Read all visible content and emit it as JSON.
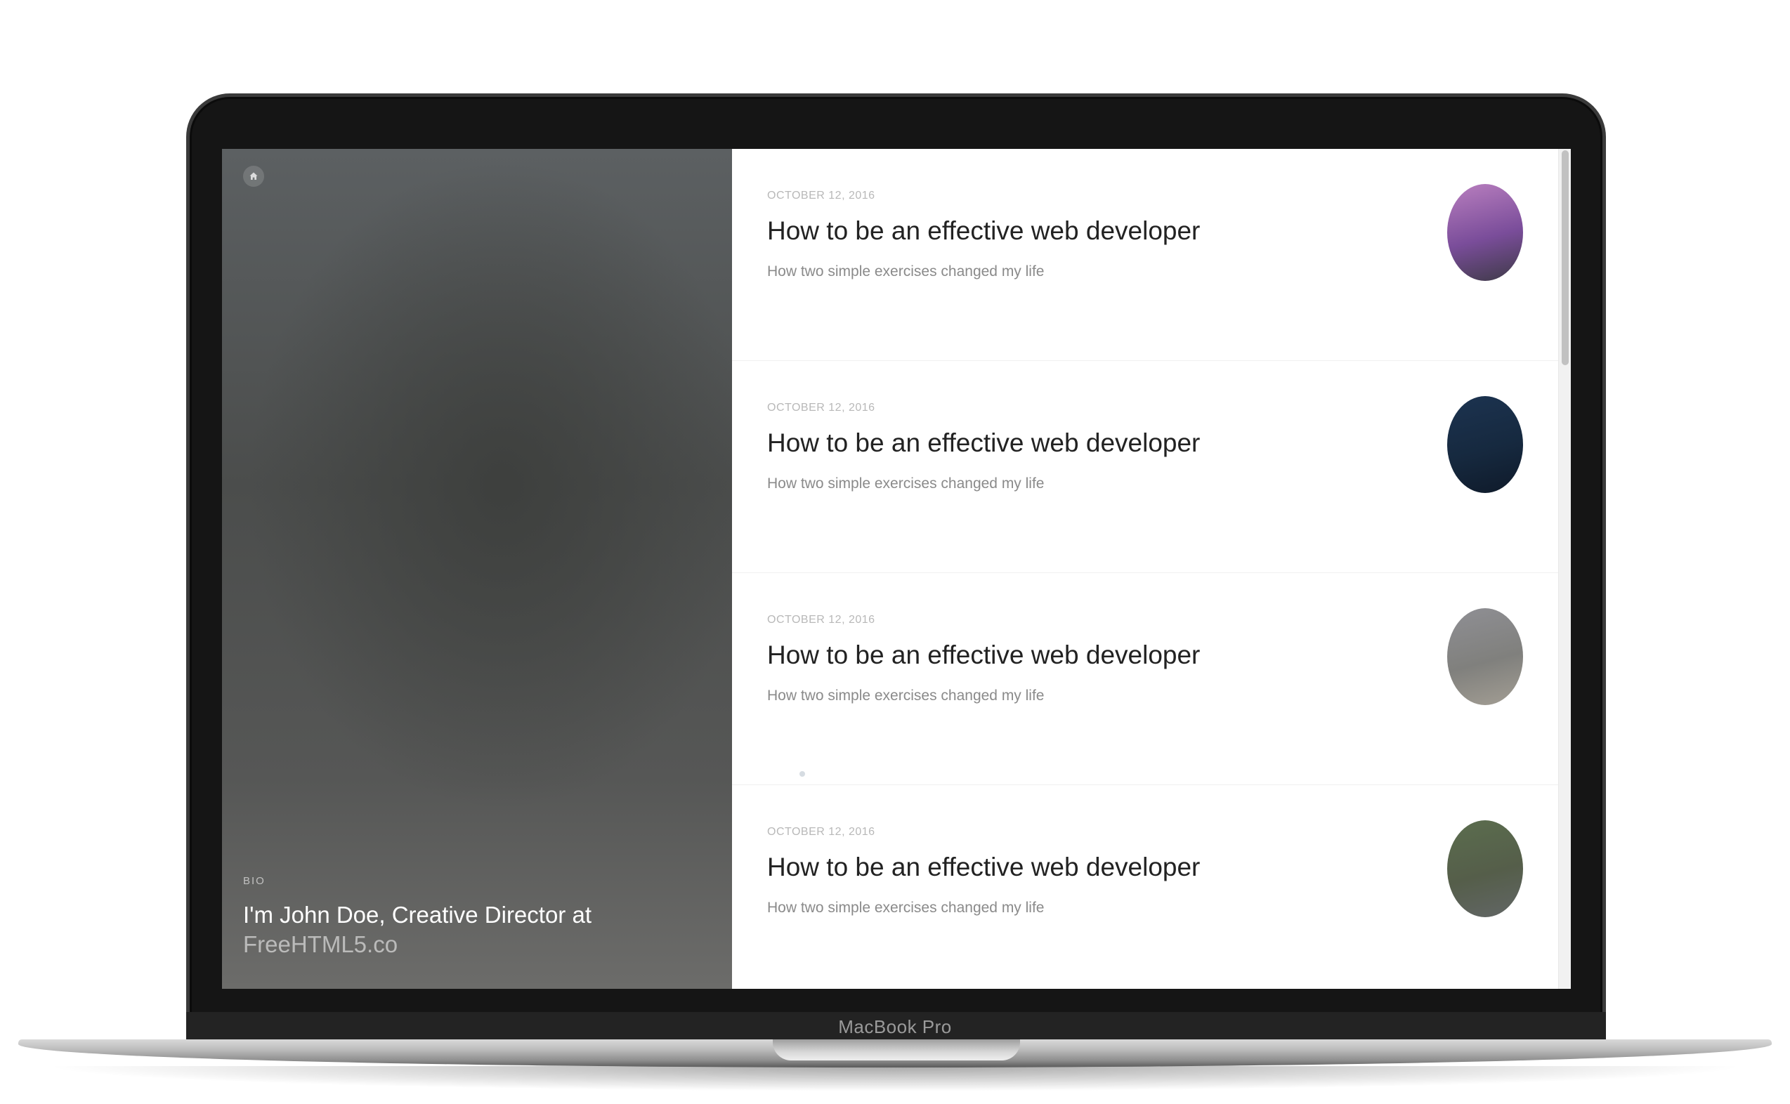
{
  "device": {
    "brand_label": "MacBook Pro"
  },
  "sidebar": {
    "home_icon": "home-icon",
    "bio_label": "BIO",
    "bio_text": "I'm John Doe, Creative Director at",
    "bio_link": "FreeHTML5.co"
  },
  "posts": [
    {
      "date": "OCTOBER 12, 2016",
      "title": "How to be an effective web developer",
      "subtitle": "How two simple exercises changed my life",
      "thumb_colors": [
        "#b97fbf",
        "#7a4d9a",
        "#3e3a47"
      ]
    },
    {
      "date": "OCTOBER 12, 2016",
      "title": "How to be an effective web developer",
      "subtitle": "How two simple exercises changed my life",
      "thumb_colors": [
        "#1c3350",
        "#16293f",
        "#0f1a2a"
      ]
    },
    {
      "date": "OCTOBER 12, 2016",
      "title": "How to be an effective web developer",
      "subtitle": "How two simple exercises changed my life",
      "thumb_colors": [
        "#8f8f94",
        "#80807d",
        "#a39e94"
      ]
    },
    {
      "date": "OCTOBER 12, 2016",
      "title": "How to be an effective web developer",
      "subtitle": "How two simple exercises changed my life",
      "thumb_colors": [
        "#5b6d4e",
        "#555e4a",
        "#626666"
      ]
    }
  ]
}
